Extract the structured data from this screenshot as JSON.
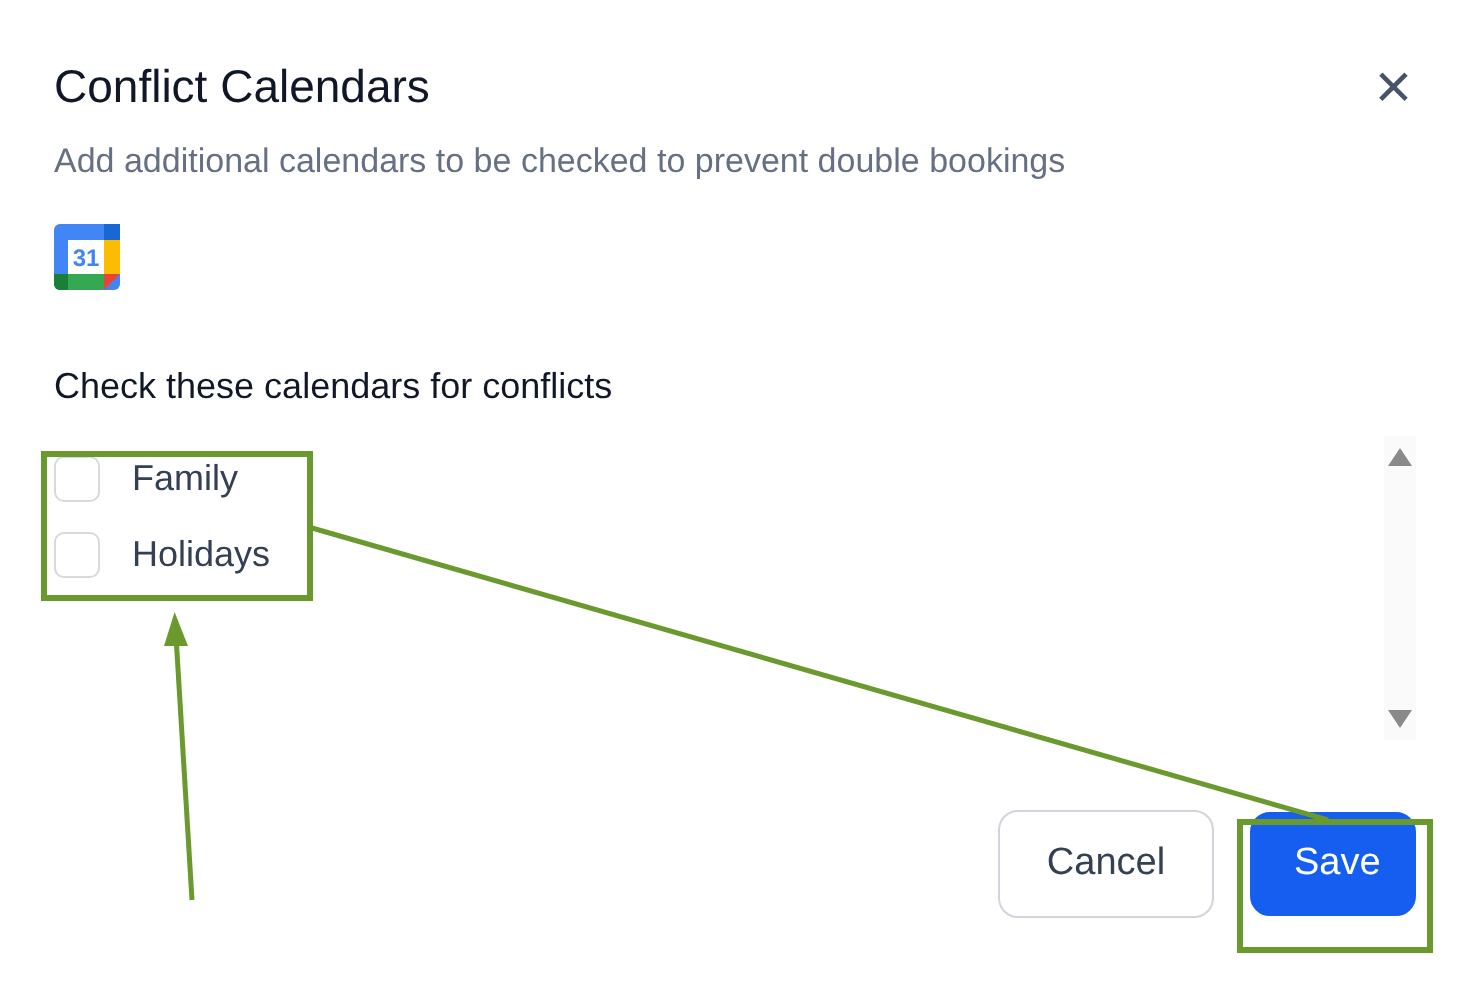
{
  "dialog": {
    "title": "Conflict Calendars",
    "close_icon": "×",
    "subtitle": "Add additional calendars to be checked to prevent double bookings",
    "calendar_icon_day": "31"
  },
  "section": {
    "label": "Check these calendars for conflicts",
    "calendars": [
      {
        "name": "Family",
        "checked": false
      },
      {
        "name": "Holidays",
        "checked": false
      }
    ]
  },
  "buttons": [
    {
      "label": "Cancel",
      "kind": "secondary"
    },
    {
      "label": "Save",
      "kind": "primary"
    }
  ]
}
